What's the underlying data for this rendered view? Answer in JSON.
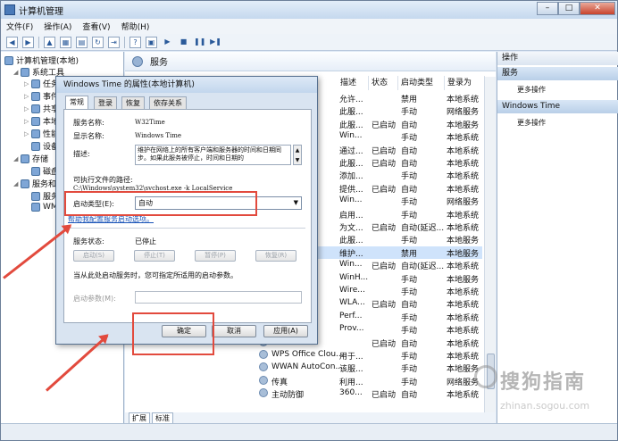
{
  "window": {
    "title": "计算机管理",
    "controls": [
      "–",
      "□",
      "✕"
    ]
  },
  "menu": [
    "文件(F)",
    "操作(A)",
    "查看(V)",
    "帮助(H)"
  ],
  "tree": [
    {
      "label": "计算机管理(本地)",
      "level": 0
    },
    {
      "label": "系统工具",
      "level": 1
    },
    {
      "label": "任务",
      "level": 2
    },
    {
      "label": "事件",
      "level": 2
    },
    {
      "label": "共享",
      "level": 2
    },
    {
      "label": "本地",
      "level": 2
    },
    {
      "label": "性能",
      "level": 2
    },
    {
      "label": "设备",
      "level": 2
    },
    {
      "label": "存储",
      "level": 1
    },
    {
      "label": "磁盘",
      "level": 2
    },
    {
      "label": "服务和",
      "level": 1
    },
    {
      "label": "服务",
      "level": 2
    },
    {
      "label": "WMI",
      "level": 2
    }
  ],
  "center": {
    "header": "服务",
    "columns": [
      "描述",
      "状态",
      "启动类型",
      "登录为"
    ],
    "rows": [
      {
        "name": "",
        "desc": "允许...",
        "status": "",
        "startup": "禁用",
        "logon": "本地系统"
      },
      {
        "name": "ent",
        "desc": "此服...",
        "status": "",
        "startup": "手动",
        "logon": "网络服务"
      },
      {
        "name": "ent",
        "desc": "此服...",
        "status": "已启动",
        "startup": "自动",
        "logon": "本地服务"
      },
      {
        "name": "ewall",
        "desc": "Win...",
        "status": "",
        "startup": "手动",
        "logon": "本地系统"
      },
      {
        "name": "nt C...",
        "desc": "通过...",
        "status": "已启动",
        "startup": "自动",
        "logon": "本地系统"
      },
      {
        "name": "ent",
        "desc": "此服...",
        "status": "已启动",
        "startup": "自动",
        "logon": "本地系统"
      },
      {
        "name": "taller",
        "desc": "添加...",
        "status": "",
        "startup": "手动",
        "logon": "本地系统"
      },
      {
        "name": "nana...",
        "desc": "提供...",
        "status": "已启动",
        "startup": "自动",
        "logon": "本地系统"
      },
      {
        "name": "edia ...",
        "desc": "Win...",
        "status": "",
        "startup": "手动",
        "logon": "网络服务"
      },
      {
        "name": "odul...",
        "desc": "启用...",
        "status": "",
        "startup": "手动",
        "logon": "本地系统"
      },
      {
        "name": "rch",
        "desc": "为文...",
        "status": "已启动",
        "startup": "自动(延迟...",
        "logon": "本地系统"
      },
      {
        "name": "esen...",
        "desc": "此服...",
        "status": "",
        "startup": "手动",
        "logon": "本地服务"
      },
      {
        "name": "ne",
        "desc": "维护...",
        "status": "",
        "startup": "禁用",
        "logon": "本地服务"
      },
      {
        "name": "eb P...",
        "desc": "Win...",
        "status": "已启动",
        "startup": "自动(延迟...",
        "logon": "本地系统"
      },
      {
        "name": "eb P...",
        "desc": "WinH...",
        "status": "",
        "startup": "手动",
        "logon": "本地服务"
      },
      {
        "name": "onfig",
        "desc": "Wire...",
        "status": "",
        "startup": "手动",
        "logon": "本地系统"
      },
      {
        "name": "onfig",
        "desc": "WLA...",
        "status": "已启动",
        "startup": "自动",
        "logon": "本地系统"
      },
      {
        "name": "ance...",
        "desc": "Perf...",
        "status": "",
        "startup": "手动",
        "logon": "本地系统"
      },
      {
        "name": "ation",
        "desc": "Prov...",
        "status": "",
        "startup": "手动",
        "logon": "本地系统"
      },
      {
        "name": "",
        "desc": "",
        "status": "已启动",
        "startup": "自动",
        "logon": "本地系统"
      },
      {
        "name": "WPS Office Clou...",
        "desc": "用于...",
        "status": "",
        "startup": "手动",
        "logon": "本地系统"
      },
      {
        "name": "WWAN AutoCon...",
        "desc": "该服...",
        "status": "",
        "startup": "手动",
        "logon": "本地服务"
      },
      {
        "name": "传真",
        "desc": "利用...",
        "status": "",
        "startup": "手动",
        "logon": "网络服务"
      },
      {
        "name": "主动防御",
        "desc": "360...",
        "status": "已启动",
        "startup": "自动",
        "logon": "本地系统"
      }
    ],
    "bottom_tabs": [
      "扩展",
      "标准"
    ]
  },
  "actions": {
    "title": "操作",
    "sections": [
      {
        "header": "服务",
        "item": "更多操作"
      },
      {
        "header": "Windows Time",
        "item": "更多操作"
      }
    ]
  },
  "dialog": {
    "title": "Windows Time 的属性(本地计算机)",
    "tabs": [
      "常规",
      "登录",
      "恢复",
      "依存关系"
    ],
    "service_name_label": "服务名称:",
    "service_name": "W32Time",
    "display_name_label": "显示名称:",
    "display_name": "Windows Time",
    "desc_label": "描述:",
    "desc": "维护在网络上的所有客户端和服务器的时间和日期同步。如果此服务被停止，时间和日期的",
    "path_label": "可执行文件的路径:",
    "path": "C:\\Windows\\system32\\svchost.exe -k LocalService",
    "startup_label": "启动类型(E):",
    "startup_value": "自动",
    "help_link": "帮助我配置服务启动选项。",
    "status_label": "服务状态:",
    "status_value": "已停止",
    "btn_start": "启动(S)",
    "btn_stop": "停止(T)",
    "btn_pause": "暂停(P)",
    "btn_resume": "恢复(R)",
    "hint": "当从此处启动服务时，您可指定所适用的启动参数。",
    "param_label": "启动参数(M):",
    "ok": "确定",
    "cancel": "取消",
    "apply": "应用(A)"
  },
  "watermark": {
    "text": "搜狗指南",
    "url": "zhinan.sogou.com"
  },
  "colors": {
    "highlight": "#e24a3d",
    "link": "#1a54b8"
  }
}
